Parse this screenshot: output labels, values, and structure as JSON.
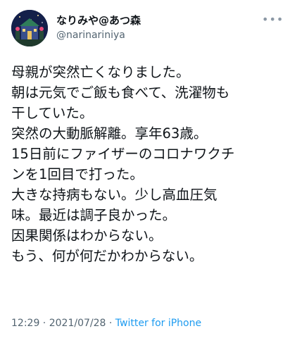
{
  "user": {
    "display_name": "なりみや@あつ森",
    "handle": "@narinariniya",
    "avatar_icon": "avatar-image"
  },
  "more_icon": "more-options-icon",
  "tweet": {
    "lines": [
      "母親が突然亡くなりました。",
      "朝は元気でご飯も食べて、洗濯物も",
      "干していた。",
      "突然の大動脈解離。享年63歳。",
      "15日前にファイザーのコロナワクチ",
      "ンを1回目で打った。",
      "大きな持病もない。少し高血圧気",
      "味。最近は調子良かった。",
      "因果関係はわからない。",
      "もう、何が何だかわからない。"
    ]
  },
  "meta": {
    "time": "12:29",
    "separator1": " · ",
    "date": "2021/07/28",
    "separator2": " · ",
    "source": "Twitter for iPhone"
  },
  "colors": {
    "text": "#0f1419",
    "secondary": "#536471",
    "link": "#1d9bf0"
  }
}
